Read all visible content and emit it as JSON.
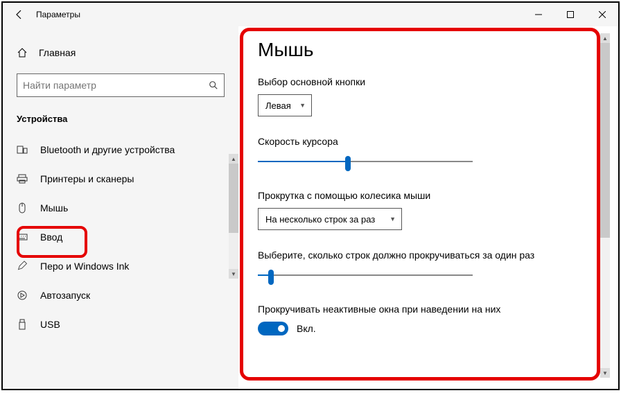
{
  "window": {
    "title": "Параметры"
  },
  "sidebar": {
    "home": "Главная",
    "search_placeholder": "Найти параметр",
    "category": "Устройства",
    "items": [
      {
        "label": "Bluetooth и другие устройства"
      },
      {
        "label": "Принтеры и сканеры"
      },
      {
        "label": "Мышь"
      },
      {
        "label": "Ввод"
      },
      {
        "label": "Перо и Windows Ink"
      },
      {
        "label": "Автозапуск"
      },
      {
        "label": "USB"
      }
    ]
  },
  "main": {
    "title": "Мышь",
    "primary_button_label": "Выбор основной кнопки",
    "primary_button_value": "Левая",
    "cursor_speed_label": "Скорость курсора",
    "cursor_speed_percent": 42,
    "scroll_wheel_label": "Прокрутка с помощью колесика мыши",
    "scroll_wheel_value": "На несколько строк за раз",
    "lines_label": "Выберите, сколько строк должно прокручиваться за один раз",
    "lines_percent": 6,
    "inactive_windows_label": "Прокручивать неактивные окна при наведении на них",
    "toggle_on_label": "Вкл."
  }
}
